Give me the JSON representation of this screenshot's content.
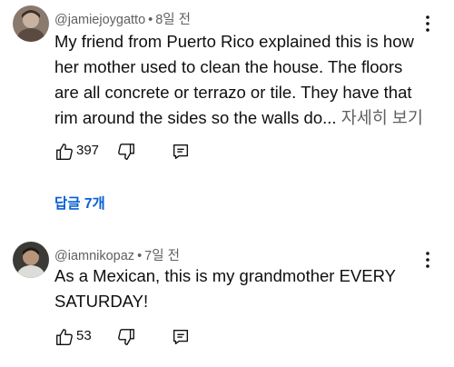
{
  "comments": [
    {
      "handle": "@jamiejoygatto",
      "separator": "•",
      "time": "8일 전",
      "lines": [
        "My friend from Puerto Rico explained this is how",
        "her mother used to clean the house. The floors",
        "are all concrete or terrazo or tile. They have that",
        "rim around the sides so the walls do..."
      ],
      "read_more": "자세히 보기",
      "likes": "397",
      "replies_label": "답글 7개"
    },
    {
      "handle": "@iamnikopaz",
      "separator": "•",
      "time": "7일 전",
      "lines": [
        "As a Mexican, this is my grandmother EVERY",
        "SATURDAY!"
      ],
      "likes": "53"
    }
  ],
  "colors": {
    "link_blue": "#065fd4",
    "meta_gray": "#606060",
    "text": "#0f0f0f"
  },
  "icons": [
    "avatar",
    "kebab-menu-icon",
    "thumbs-up-icon",
    "thumbs-down-icon",
    "reply-icon"
  ]
}
